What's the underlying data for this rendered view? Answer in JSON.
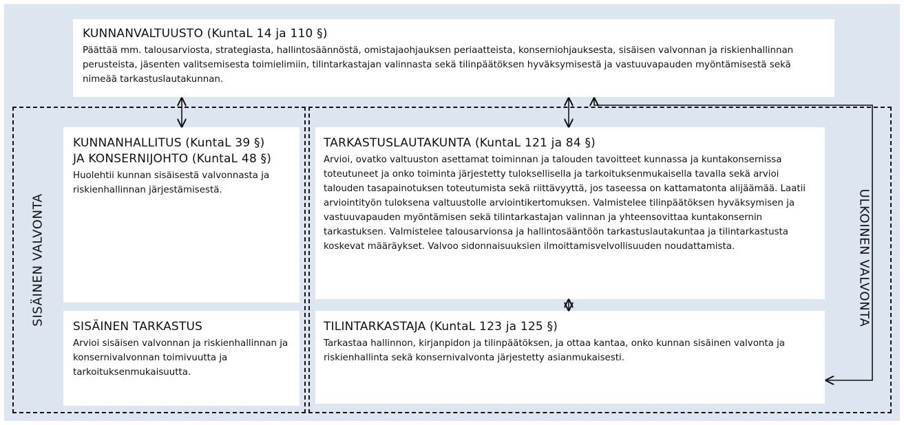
{
  "council": {
    "title": "KUNNANVALTUUSTO (KuntaL 14 ja 110 §)",
    "description": "Päättää mm. talousarviosta, strategiasta, hallintosäännöstä, omistajaohjauksen periaatteista, konserniohjauksesta, sisäisen valvonnan ja riskienhallinnan perusteista, jäsenten valitsemisesta toimielimiin, tilintarkastajan valinnasta sekä tilinpäätöksen hyväksymisestä ja vastuuvapauden myöntämisestä sekä nimeää tarkastuslautakunnan."
  },
  "board": {
    "title_line1": "KUNNANHALLITUS (KuntaL 39 §)",
    "title_line2": "JA KONSERNIJOHTO (KuntaL 48 §)",
    "description": "Huolehtii kunnan sisäisestä valvonnasta ja riskienhallinnan järjestämisestä."
  },
  "internal_audit": {
    "title": "SISÄINEN TARKASTUS",
    "description": "Arvioi sisäisen valvonnan ja riskienhallinnan ja konsernivalvonnan toimivuutta ja tarkoituksenmukaisuutta."
  },
  "audit_committee": {
    "title": "TARKASTUSLAUTAKUNTA (KuntaL 121 ja 84 §)",
    "description": "Arvioi, ovatko valtuuston asettamat toiminnan ja talouden tavoitteet kunnassa ja kuntakonsernissa toteutuneet ja onko toiminta järjestetty tuloksellisella ja tarkoituksenmukaisella tavalla sekä arvioi talouden tasapainotuksen toteutumista sekä riittävyyttä, jos taseessa on kattamatonta alijäämää. Laatii arviointityön tuloksena valtuustolle arviointikertomuksen. Valmistelee tilinpäätöksen hyväksymisen ja vastuuvapauden myöntämisen sekä tilintarkastajan valinnan ja yhteensovittaa kuntakonsernin tarkastuksen. Valmistelee talousarvionsa ja hallintosääntöön tarkastuslautakuntaa ja tilintarkastusta koskevat määräykset. Valvoo sidonnaisuuksien ilmoittamisvelvollisuuden noudattamista."
  },
  "auditor": {
    "title": "TILINTARKASTAJA (KuntaL 123 ja 125 §)",
    "description": "Tarkastaa hallinnon, kirjanpidon ja tilinpäätöksen, ja ottaa kantaa, onko kunnan sisäinen valvonta ja riskienhallinta sekä konsernivalvonta järjestetty asianmukaisesti."
  },
  "labels": {
    "internal_control": "SISÄINEN VALVONTA",
    "external_control": "ULKOINEN VALVONTA"
  },
  "colors": {
    "background": "#dde5f0",
    "box": "#ffffff",
    "line": "#111111"
  }
}
